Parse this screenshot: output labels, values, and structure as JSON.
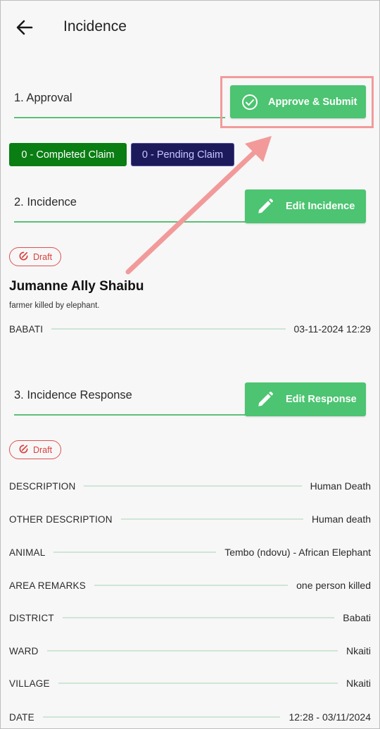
{
  "header": {
    "title": "Incidence",
    "back_icon": "arrow-left-icon"
  },
  "approval": {
    "title": "1. Approval",
    "button_label": "Approve & Submit",
    "button_icon": "check-circle-icon",
    "completed_claims": "0 - Completed Claim",
    "pending_claims": "0 - Pending Claim"
  },
  "incidence": {
    "title": "2. Incidence",
    "edit_label": "Edit Incidence",
    "edit_icon": "pencil-icon",
    "status": "Draft",
    "name": "Jumanne Ally Shaibu",
    "note": "farmer  killed by elephant.",
    "location": "BABATI",
    "datetime": "03-11-2024  12:29"
  },
  "response": {
    "title": "3. Incidence Response",
    "edit_label": "Edit Response",
    "edit_icon": "pencil-icon",
    "status": "Draft",
    "fields": [
      {
        "label": "DESCRIPTION",
        "value": "Human Death"
      },
      {
        "label": "OTHER DESCRIPTION",
        "value": "Human death"
      },
      {
        "label": "ANIMAL",
        "value": "Tembo (ndovu) - African Elephant"
      },
      {
        "label": "AREA REMARKS",
        "value": "one person killed"
      },
      {
        "label": "DISTRICT",
        "value": "Babati"
      },
      {
        "label": "WARD",
        "value": "Nkaiti"
      },
      {
        "label": "VILLAGE",
        "value": "Nkaiti"
      },
      {
        "label": "DATE",
        "value": "12:28 - 03/11/2024"
      }
    ]
  },
  "colors": {
    "accent_green": "#4cc471",
    "completed": "#0a7d13",
    "pending": "#1d1a5c",
    "draft": "#d94040",
    "annotation": "#f29a9a"
  }
}
